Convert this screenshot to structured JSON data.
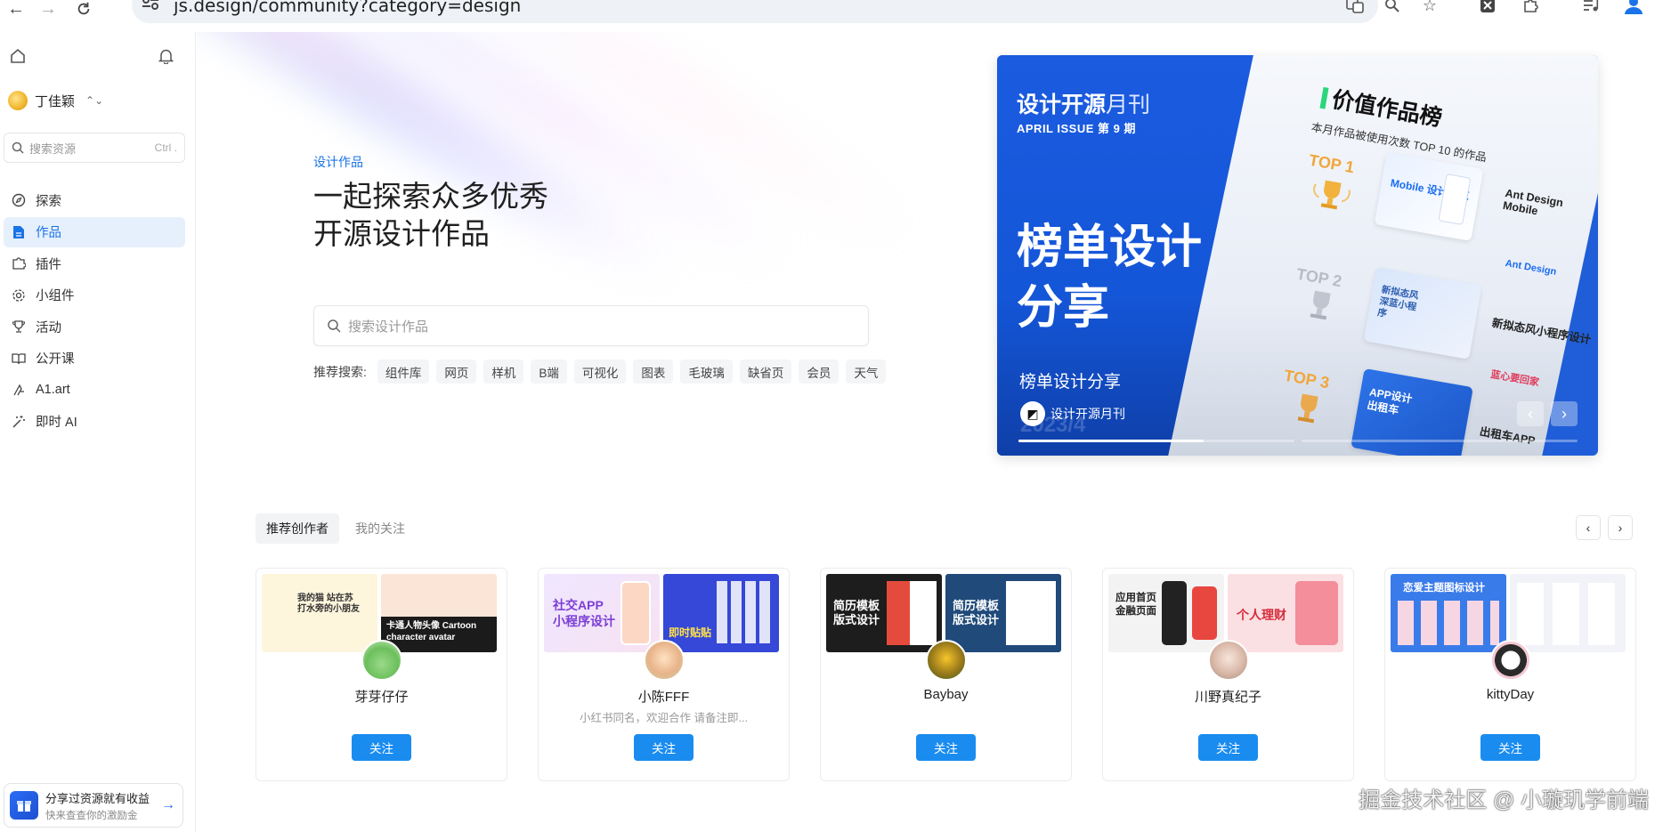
{
  "browser": {
    "url": "js.design/community?category=design"
  },
  "sidebar": {
    "user_name": "丁佳颖",
    "search_placeholder": "搜索资源",
    "search_shortcut": "Ctrl .",
    "items": [
      {
        "label": "探索",
        "icon": "compass-icon",
        "active": false
      },
      {
        "label": "作品",
        "icon": "file-icon",
        "active": true
      },
      {
        "label": "插件",
        "icon": "puzzle-icon",
        "active": false
      },
      {
        "label": "小组件",
        "icon": "gear-icon",
        "active": false
      },
      {
        "label": "活动",
        "icon": "trophy-icon",
        "active": false
      },
      {
        "label": "公开课",
        "icon": "book-icon",
        "active": false
      },
      {
        "label": "A1.art",
        "icon": "art-icon",
        "active": false
      },
      {
        "label": "即时 AI",
        "icon": "magic-wand-icon",
        "active": false
      }
    ],
    "promo_title": "分享过资源就有收益",
    "promo_subtitle": "快来查查你的激励金"
  },
  "hero": {
    "eyebrow": "设计作品",
    "title_line1": "一起探索众多优秀",
    "title_line2": "开源设计作品",
    "search_placeholder": "搜索设计作品",
    "tags_label": "推荐搜索:",
    "tags": [
      "组件库",
      "网页",
      "样机",
      "B端",
      "可视化",
      "图表",
      "毛玻璃",
      "缺省页",
      "会员",
      "天气"
    ]
  },
  "banner": {
    "brand": "设计开源",
    "brand_thin": "月刊",
    "issue": "APRIL ISSUE  第 9 期",
    "headline_line1": "榜单设计",
    "headline_line2": "分享",
    "subtitle": "榜单设计分享",
    "logo_text": "设计开源月刊",
    "date": "2023/4",
    "rank_title": "价值作品榜",
    "rank_subtitle": "本月作品被使用次数 TOP 10 的作品",
    "top1": "TOP 1",
    "top2": "TOP 2",
    "top3": "TOP 3",
    "item1_title": "Ant Design Mobile",
    "item1_card": "Mobile 设计规范",
    "item2_title": "新拟态风小程序设计",
    "item2_card": "新拟态风 深蓝小程序",
    "item2_logo": "Ant Design",
    "item3_title": "出租车APP",
    "item3_card": "APP设计 出租车",
    "item3_logo": "蓝心要回家",
    "progress": 0.67
  },
  "creators": {
    "tabs": [
      "推荐创作者",
      "我的关注"
    ],
    "follow_label": "关注",
    "cards": [
      {
        "name": "芽芽仔仔",
        "bio": "",
        "thumb1": "我的猫 站在苏打水旁的小朋友",
        "thumb2": "卡通人物头像 Cartoon character avatar"
      },
      {
        "name": "小陈FFF",
        "bio": "小红书同名，欢迎合作 请备注即...",
        "thumb1": "社交APP 小程序设计",
        "thumb2": "即时贴贴"
      },
      {
        "name": "Baybay",
        "bio": "",
        "thumb1": "简历模板 版式设计",
        "thumb2": "简历模板 版式设计"
      },
      {
        "name": "川野真纪子",
        "bio": "",
        "thumb1": "应用首页 金融页面",
        "thumb2": "个人理财"
      },
      {
        "name": "kittyDay",
        "bio": "",
        "thumb1": "恋爱主题图标设计",
        "thumb2": ""
      }
    ]
  },
  "watermark": "掘金技术社区 @ 小璇玑学前端"
}
